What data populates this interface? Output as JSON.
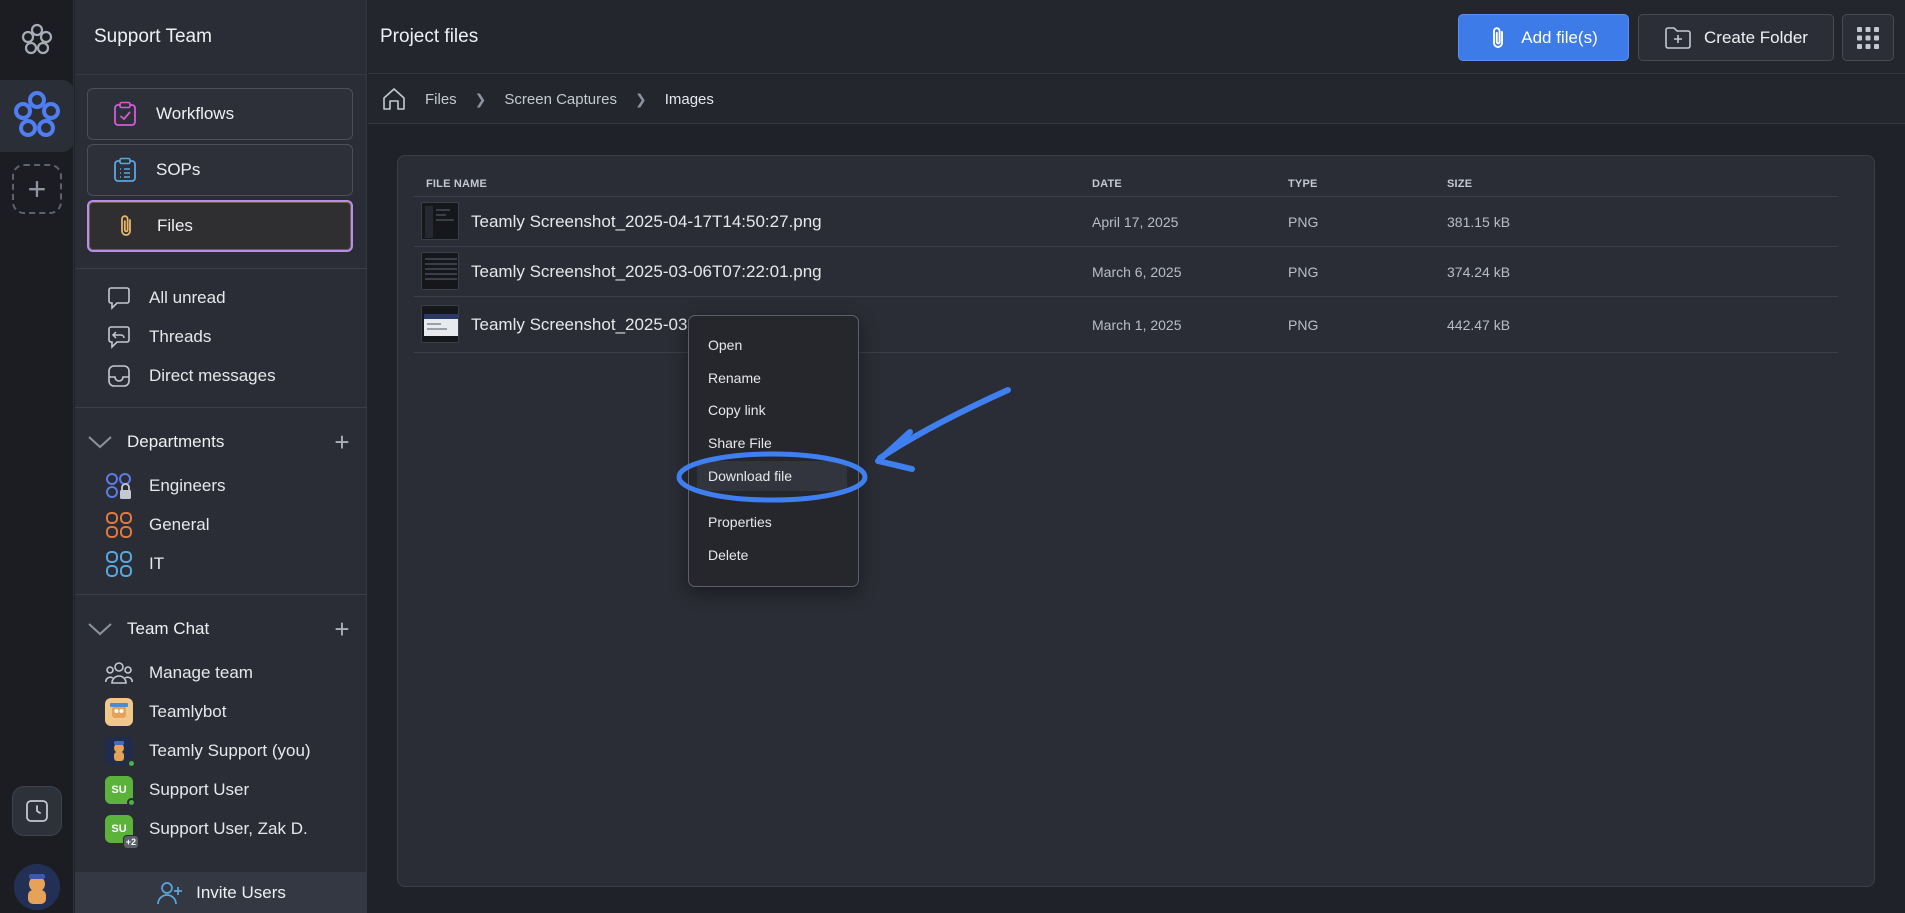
{
  "app": {
    "team_name": "Support Team",
    "page_title": "Project files",
    "accent": "#3d7be8"
  },
  "sidebar": {
    "pills": [
      {
        "label": "Workflows",
        "icon": "clipboard-check-icon"
      },
      {
        "label": "SOPs",
        "icon": "list-clipboard-icon"
      },
      {
        "label": "Files",
        "icon": "paperclip-icon",
        "active": true
      }
    ],
    "nav": [
      {
        "label": "All unread",
        "icon": "chat-bubble-icon"
      },
      {
        "label": "Threads",
        "icon": "threads-icon"
      },
      {
        "label": "Direct messages",
        "icon": "inbox-icon"
      }
    ],
    "departments": {
      "title": "Departments",
      "items": [
        {
          "label": "Engineers",
          "color": "#5b7de8",
          "locked": true
        },
        {
          "label": "General",
          "color": "#e07a3f"
        },
        {
          "label": "IT",
          "color": "#5aa7e0"
        }
      ]
    },
    "team_chat": {
      "title": "Team Chat",
      "items": [
        {
          "label": "Manage team",
          "icon": "team-icon"
        },
        {
          "label": "Teamlybot",
          "avatar": "bot"
        },
        {
          "label": "Teamly Support (you)",
          "avatar": "support"
        },
        {
          "label": "Support User",
          "avatar_text": "SU"
        },
        {
          "label": "Support User, Zak D.",
          "avatar_text": "SU",
          "badge": "+2"
        }
      ]
    },
    "invite_label": "Invite Users"
  },
  "toolbar": {
    "add_label": "Add file(s)",
    "folder_label": "Create Folder"
  },
  "breadcrumb": [
    "Files",
    "Screen Captures",
    "Images"
  ],
  "table": {
    "headers": {
      "name": "FILE NAME",
      "date": "DATE",
      "type": "TYPE",
      "size": "SIZE"
    },
    "rows": [
      {
        "name": "Teamly Screenshot_2025-04-17T14:50:27.png",
        "date": "April 17, 2025",
        "type": "PNG",
        "size": "381.15 kB"
      },
      {
        "name": "Teamly Screenshot_2025-03-06T07:22:01.png",
        "date": "March 6, 2025",
        "type": "PNG",
        "size": "374.24 kB"
      },
      {
        "name": "Teamly Screenshot_2025-03",
        "date": "March 1, 2025",
        "type": "PNG",
        "size": "442.47 kB"
      }
    ]
  },
  "context_menu": {
    "items": [
      "Open",
      "Rename",
      "Copy link",
      "Share File",
      "Download file",
      "Properties",
      "Delete"
    ],
    "highlighted": "Download file"
  },
  "annotation": {
    "color": "#3f7ff0"
  }
}
